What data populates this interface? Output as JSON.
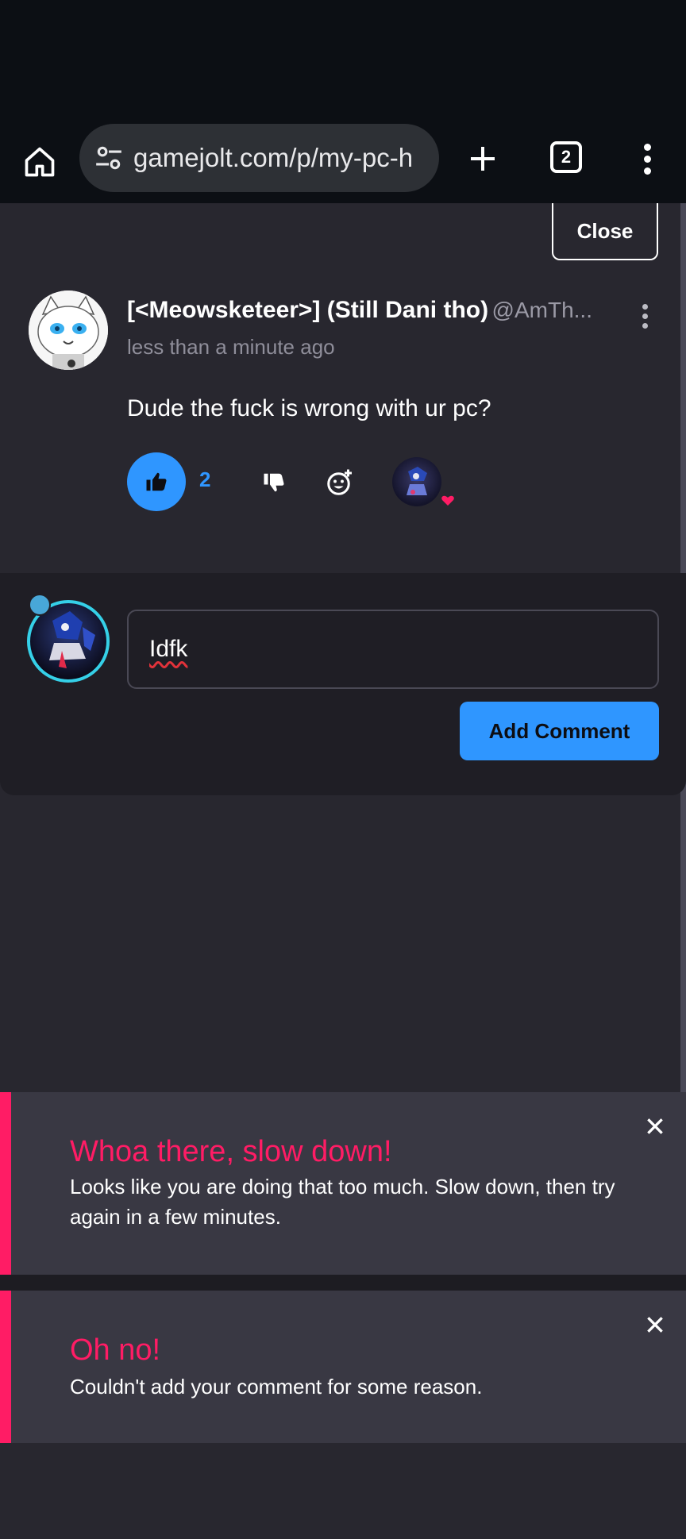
{
  "browser": {
    "url": "gamejolt.com/p/my-pc-h",
    "tab_count": "2"
  },
  "panel": {
    "close_label": "Close"
  },
  "comment": {
    "author_name": "[<Meowsketeer>] (Still Dani tho)",
    "author_handle": "@AmTh...",
    "timestamp": "less than a minute ago",
    "body": "Dude the fuck is wrong with ur pc?",
    "like_count": "2"
  },
  "reply": {
    "input_value": "Idfk",
    "submit_label": "Add Comment"
  },
  "toasts": [
    {
      "title": "Whoa there, slow down!",
      "message": "Looks like you are doing that too much. Slow down, then try again in a few minutes."
    },
    {
      "title": "Oh no!",
      "message": "Couldn't add your comment for some reason."
    }
  ],
  "colors": {
    "accent_blue": "#2f96ff",
    "error_pink": "#ff1c65",
    "background": "#28272f"
  }
}
